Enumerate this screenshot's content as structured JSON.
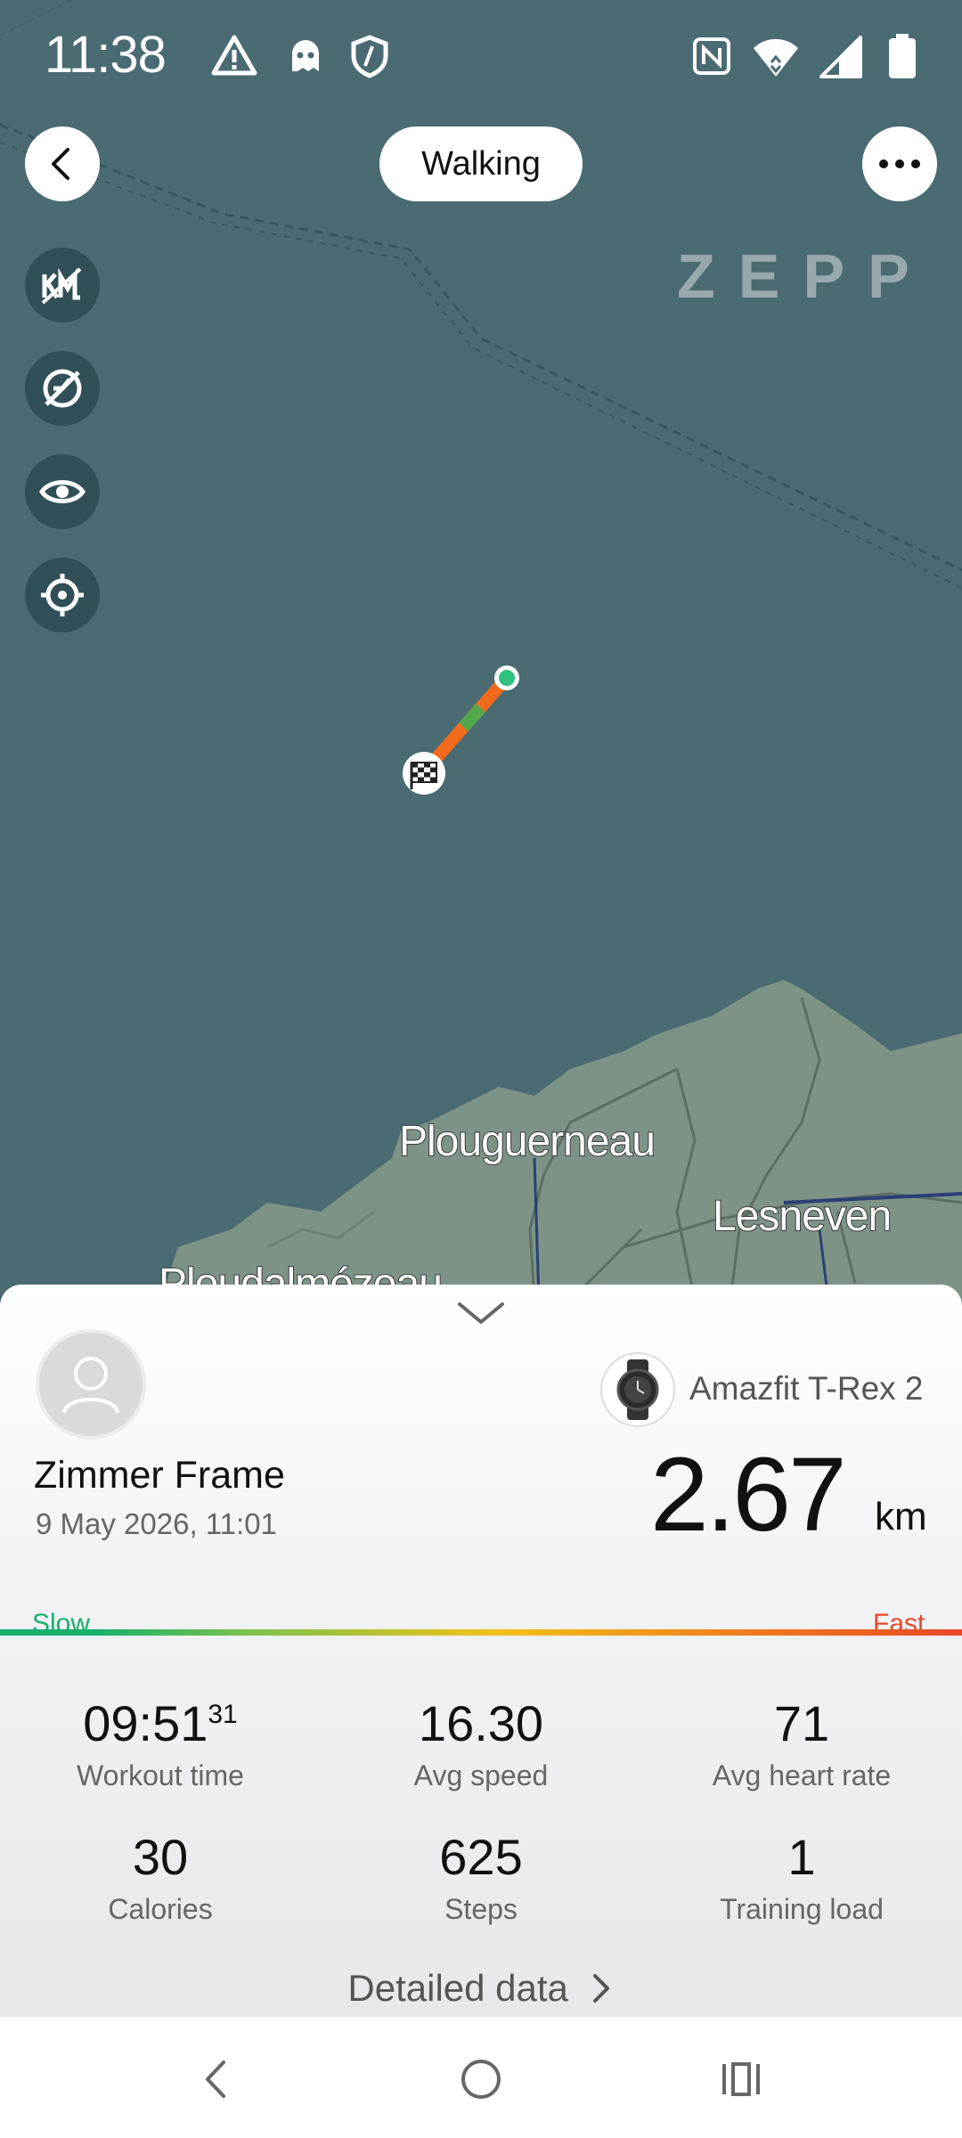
{
  "status_bar": {
    "time": "11:38"
  },
  "header": {
    "mode_label": "Walking",
    "brand": "ZEPP"
  },
  "map": {
    "labels": [
      "Plouguerneau",
      "Lesneven",
      "Ploudalmézeau"
    ]
  },
  "summary": {
    "user_name": "Zimmer Frame",
    "date_time": "9 May 2026, 11:01",
    "device": "Amazfit T-Rex 2",
    "distance": "2.67",
    "distance_unit": "km",
    "pace_scale": {
      "slow": "Slow",
      "fast": "Fast"
    },
    "stats": [
      {
        "value": "09:51",
        "value_sup": "31",
        "label": "Workout time"
      },
      {
        "value": "16.30",
        "label": "Avg speed"
      },
      {
        "value": "71",
        "label": "Avg heart rate"
      },
      {
        "value": "30",
        "label": "Calories"
      },
      {
        "value": "625",
        "label": "Steps"
      },
      {
        "value": "1",
        "label": "Training load"
      }
    ],
    "detail_link": "Detailed data"
  },
  "icons": [
    "back-arrow-icon",
    "more-icon",
    "hide-km-markers-icon",
    "hide-speed-icon",
    "eye-icon",
    "locate-icon",
    "collapse-chevron-icon",
    "avatar-icon",
    "watch-icon",
    "chevron-right-icon",
    "nav-back-icon",
    "nav-home-icon",
    "nav-recents-icon"
  ],
  "colors": {
    "sea": "#4b6b72",
    "land": "#7d9385",
    "route": "#f26b1d",
    "start": "#2ec27e",
    "slow": "#16b06b",
    "fast": "#e8482a"
  }
}
